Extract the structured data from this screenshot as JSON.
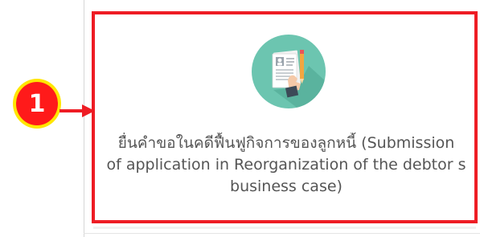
{
  "card": {
    "icon": "document-pen-icon",
    "line1": "ยื่นคำขอในคดีฟื้นฟูกิจการของลูกหนี้ (Submission",
    "line2": "of application in Reorganization of the debtor s",
    "line3": "business case)"
  },
  "callout": {
    "number": "1"
  },
  "colors": {
    "highlight": "#ee1c24",
    "callout_fill": "#ff1a1a",
    "callout_ring": "#ffe600",
    "icon_circle": "#6cc5b0",
    "text": "#555555"
  }
}
